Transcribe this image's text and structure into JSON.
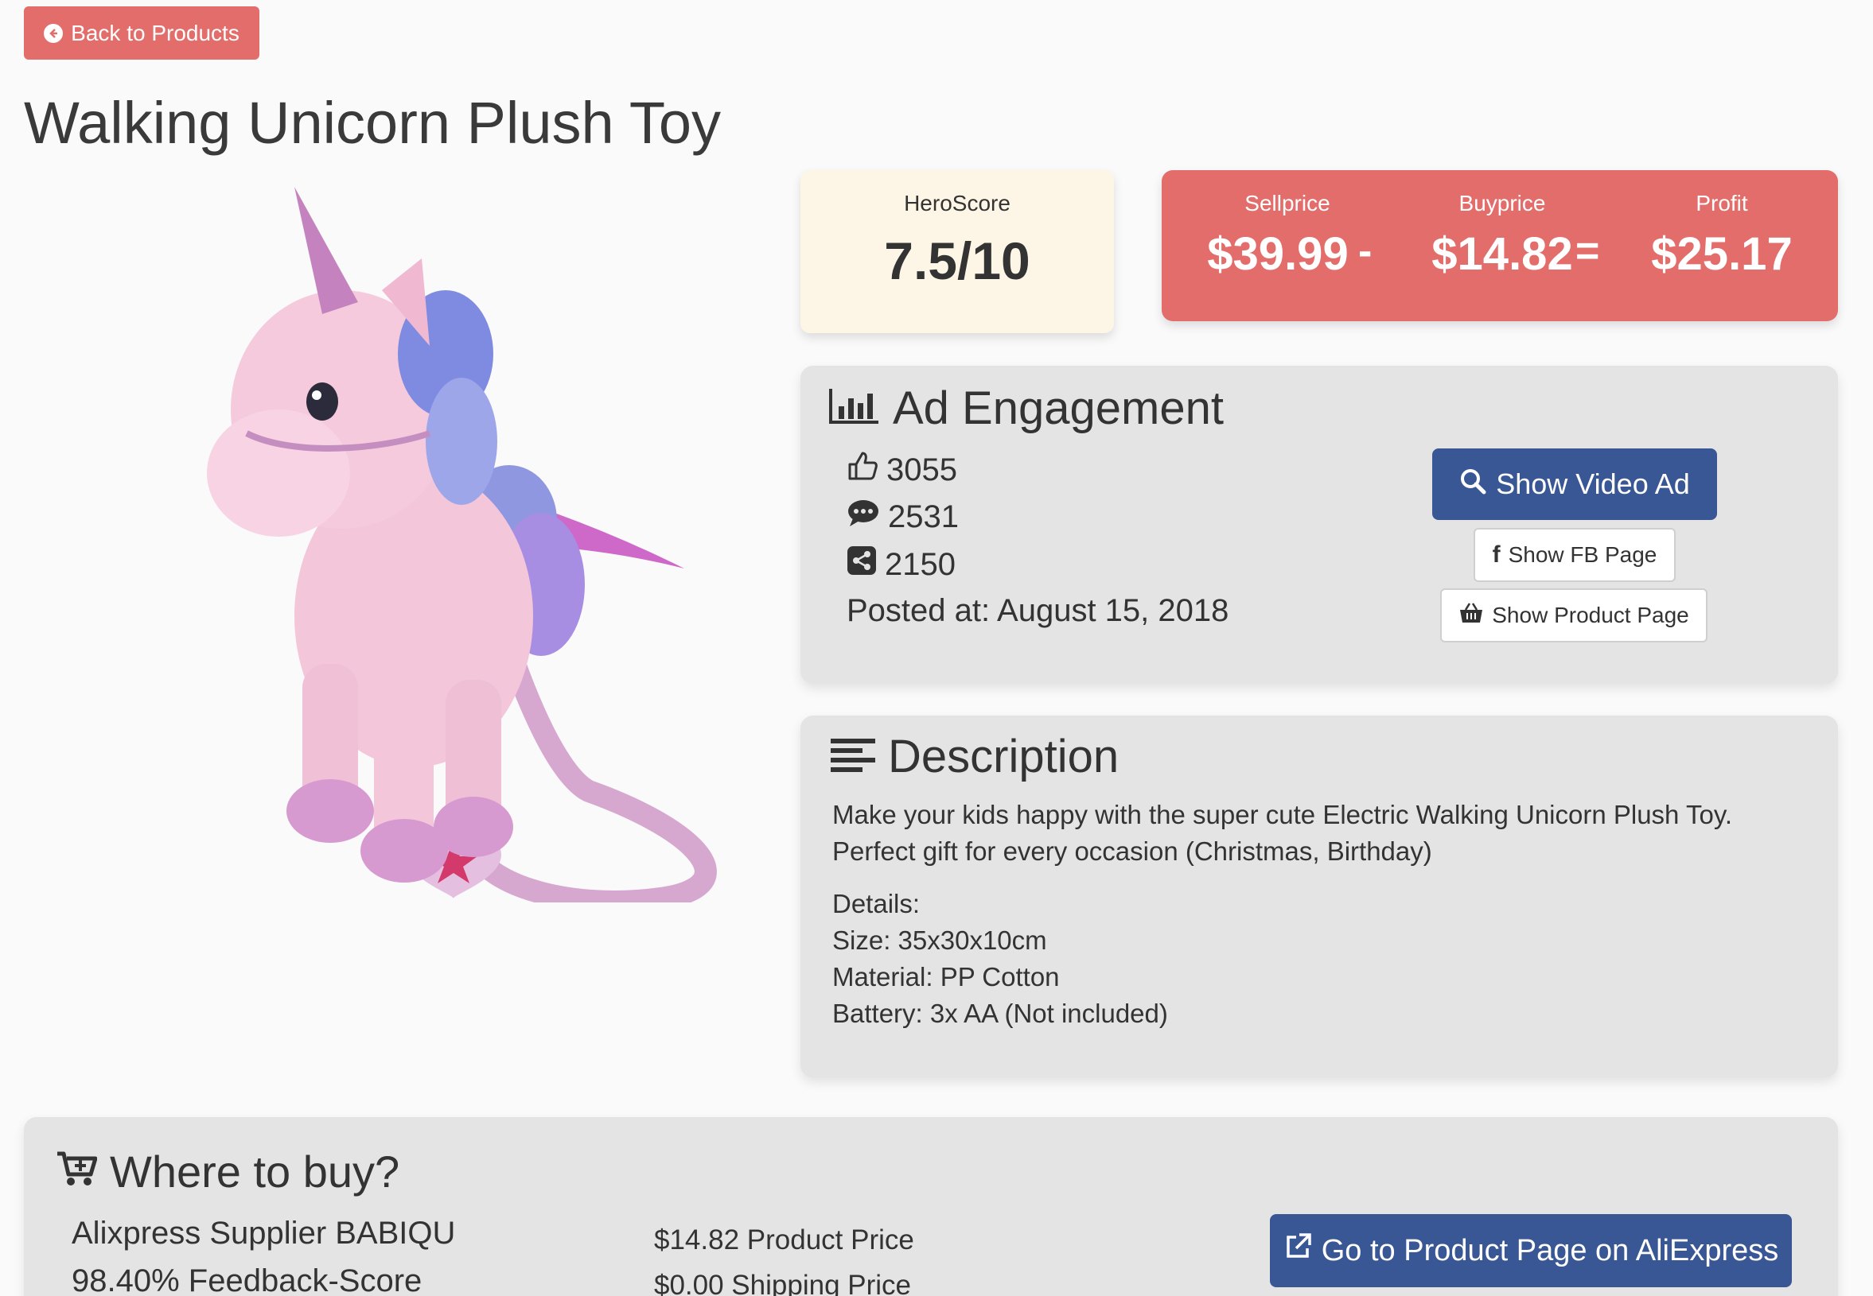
{
  "nav": {
    "back_label": "Back to Products"
  },
  "product": {
    "title": "Walking Unicorn Plush Toy"
  },
  "hero_score": {
    "label": "HeroScore",
    "value": "7.5/10"
  },
  "pricing": {
    "sell_label": "Sellprice",
    "sell_value": "$39.99",
    "buy_label": "Buyprice",
    "buy_value": "$14.82",
    "profit_label": "Profit",
    "profit_value": "$25.17",
    "minus_op": "-",
    "equals_op": "="
  },
  "ad_engagement": {
    "title": "Ad Engagement",
    "likes": "3055",
    "comments": "2531",
    "shares": "2150",
    "posted_label": "Posted at: August 15, 2018",
    "show_video_label": "Show Video Ad",
    "show_fb_label": "Show FB Page",
    "show_product_label": "Show Product Page"
  },
  "description": {
    "title": "Description",
    "line1": "Make your kids happy with the super cute Electric Walking Unicorn Plush Toy.",
    "line2": "Perfect gift for every occasion (Christmas, Birthday)",
    "details_label": "Details:",
    "size": "Size: 35x30x10cm",
    "material": "Material: PP Cotton",
    "battery": "Battery: 3x AA (Not included)"
  },
  "where_to_buy": {
    "title": "Where to buy?",
    "supplier": "Alixpress Supplier BABIQU",
    "feedback": "98.40% Feedback-Score",
    "product_price": "$14.82 Product Price",
    "shipping_price": "$0.00 Shipping Price",
    "go_label": "Go to Product Page on AliExpress"
  },
  "colors": {
    "accent_red": "#e36d6a",
    "primary_blue": "#3a5795",
    "hero_bg": "#fdf6e6",
    "panel_bg": "#e4e4e4"
  }
}
